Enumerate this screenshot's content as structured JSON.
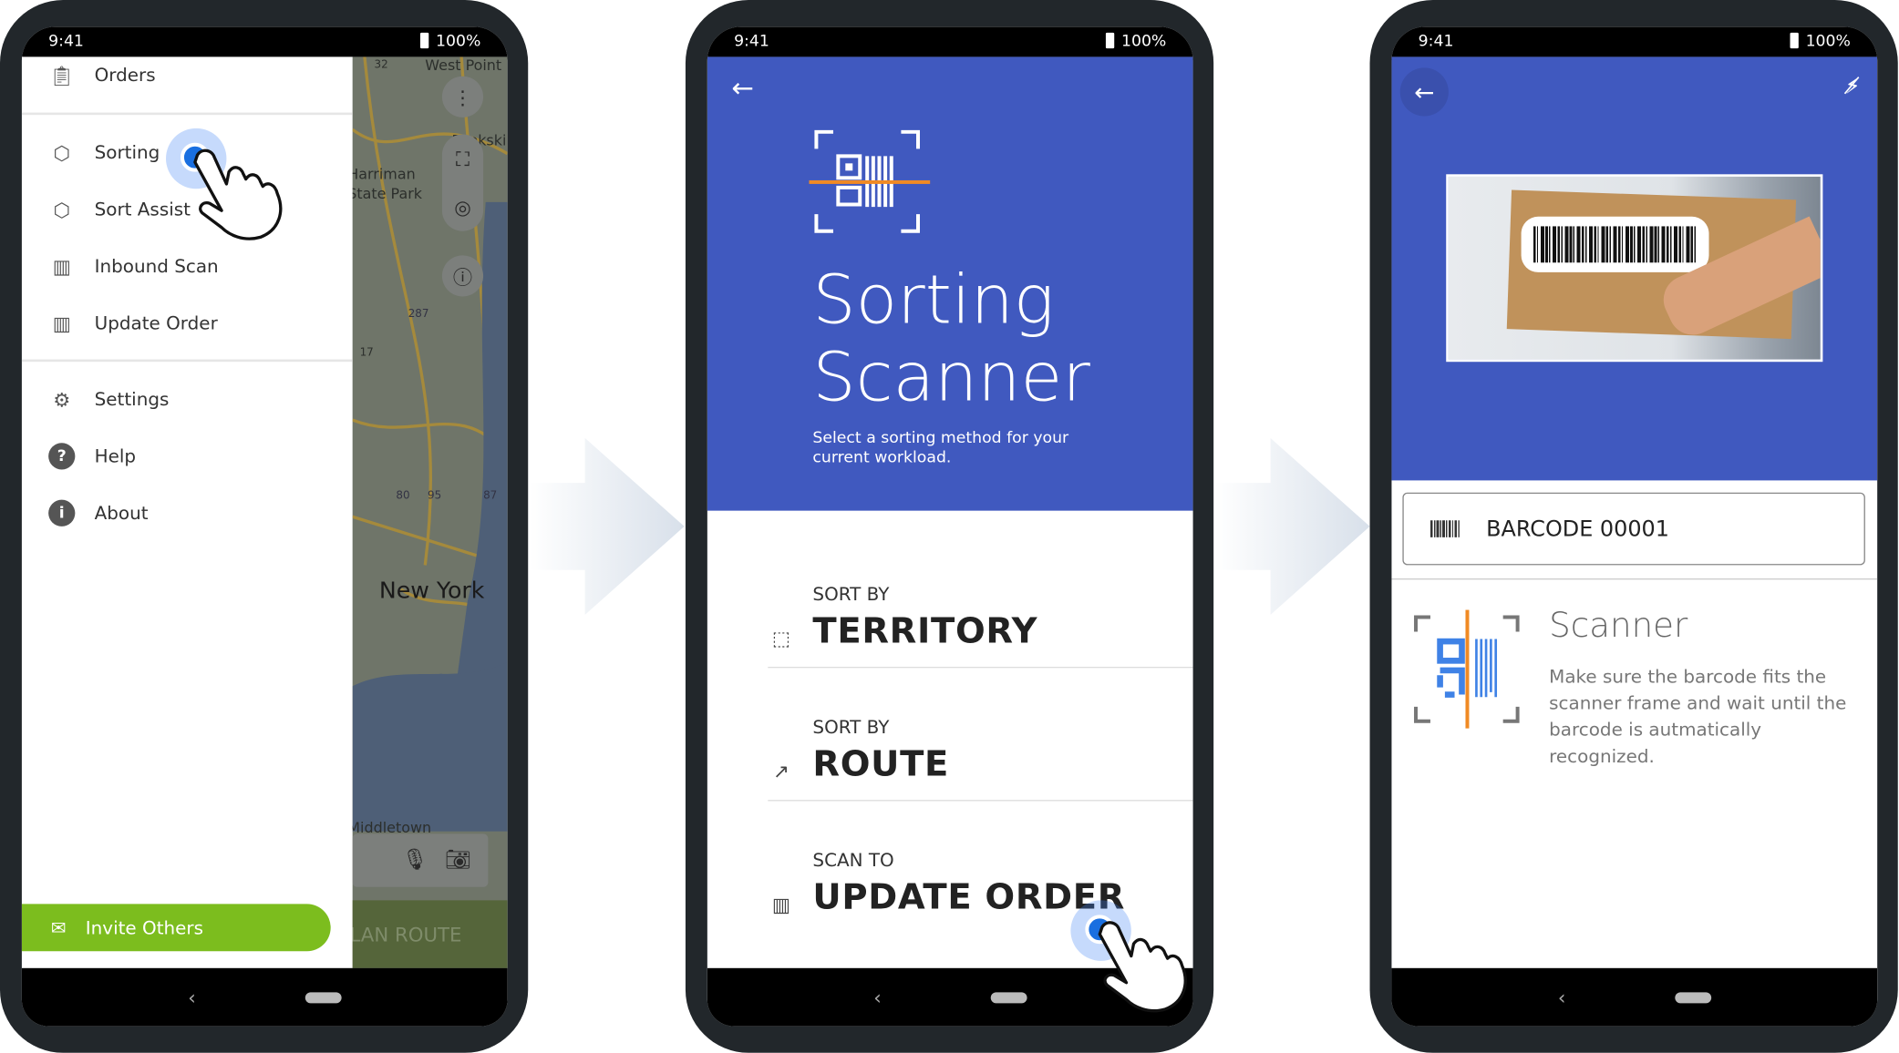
{
  "status_bar": {
    "time": "9:41",
    "battery": "100%"
  },
  "colors": {
    "primary_blue": "#4059bf",
    "invite_green": "#7cbd1e",
    "scanner_orange": "#f08a24",
    "scanner_blue": "#3f82e6",
    "frame": "#22272b"
  },
  "screen1": {
    "menu": [
      {
        "label": "Orders",
        "icon": "clipboard-icon"
      },
      {
        "label": "Sorting",
        "icon": "cube-scan-icon"
      },
      {
        "label": "Sort Assist",
        "icon": "cube-scan-icon"
      },
      {
        "label": "Inbound Scan",
        "icon": "barcode-frame-icon"
      },
      {
        "label": "Update Order",
        "icon": "barcode-check-icon"
      },
      {
        "label": "Settings",
        "icon": "gear-icon"
      },
      {
        "label": "Help",
        "icon": "help-icon"
      },
      {
        "label": "About",
        "icon": "info-icon"
      }
    ],
    "invite_label": "Invite Others",
    "map": {
      "labels": [
        "West Point",
        "Peekskill",
        "Harriman",
        "State Park",
        "New York",
        "Middletown"
      ],
      "shields": [
        "32",
        "87",
        "287",
        "17",
        "80",
        "95",
        "87"
      ],
      "plan_route": "PLAN ROUTE"
    }
  },
  "screen2": {
    "title_line1": "Sorting",
    "title_line2": "Scanner",
    "subtitle": "Select a sorting method for your current workload.",
    "options": [
      {
        "small": "SORT BY",
        "big": "TERRITORY",
        "icon": "territory-icon"
      },
      {
        "small": "SORT BY",
        "big": "ROUTE",
        "icon": "route-icon"
      },
      {
        "small": "SCAN TO",
        "big": "UPDATE ORDER",
        "icon": "barcode-check-icon"
      }
    ]
  },
  "screen3": {
    "barcode_value": "BARCODE 00001",
    "scanner_title": "Scanner",
    "scanner_text": "Make sure the barcode fits the scanner frame and wait until the barcode is autmatically recognized."
  }
}
